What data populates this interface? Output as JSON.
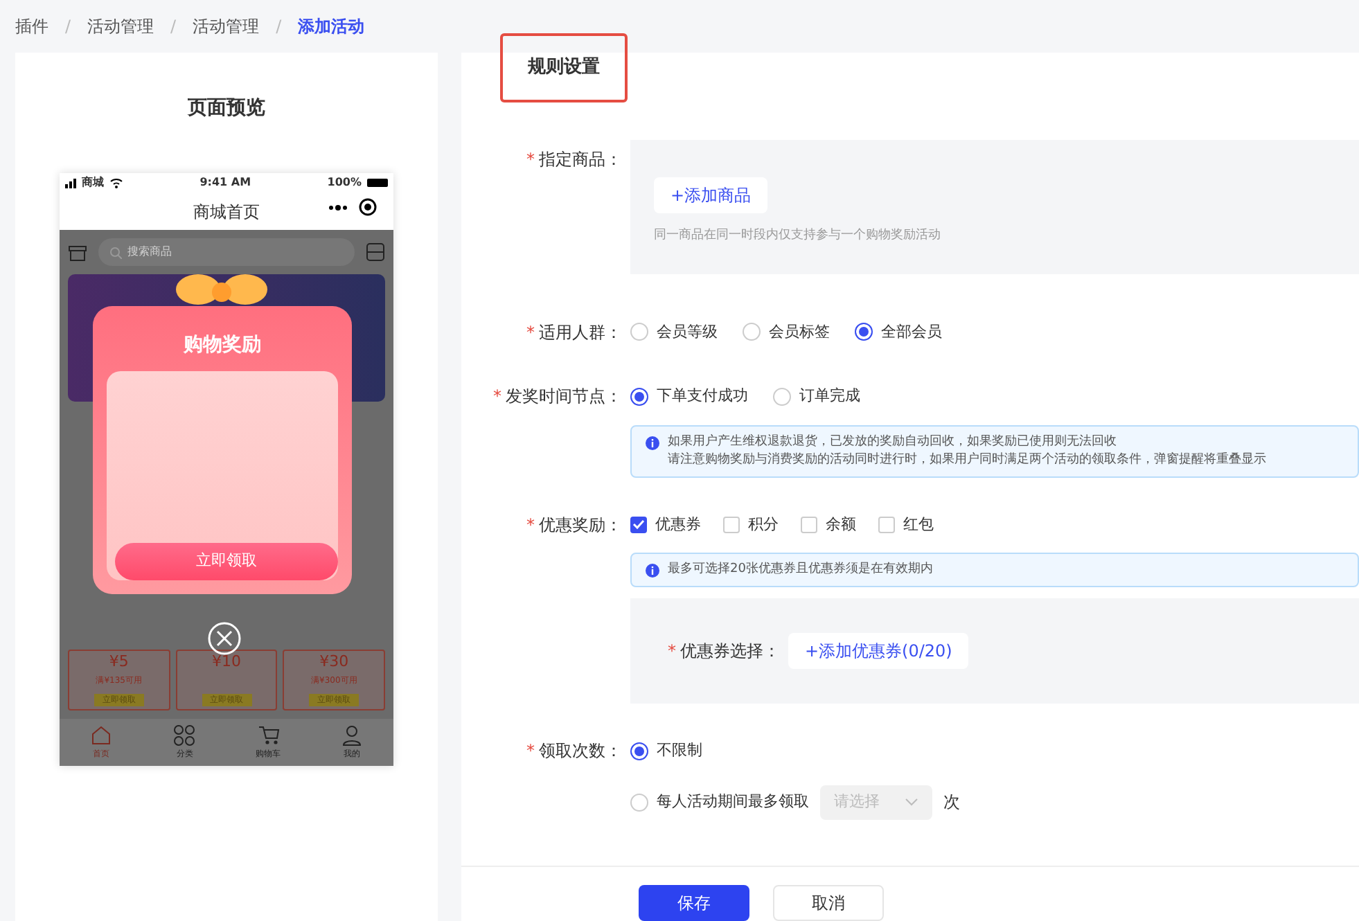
{
  "breadcrumb_separator": "/",
  "breadcrumb": [
    {
      "label": "插件",
      "selected": false
    },
    {
      "label": "活动管理",
      "selected": false
    },
    {
      "label": "活动管理",
      "selected": false
    },
    {
      "label": "添加活动",
      "selected": true
    }
  ],
  "preview": {
    "title": "页面预览",
    "phone": {
      "carrier": "商城",
      "time": "9:41 AM",
      "battery": "100%",
      "page_title": "商城首页",
      "search_placeholder": "搜索商品",
      "popup": {
        "title": "购物奖励",
        "button": "立即领取"
      },
      "coupons": [
        {
          "value": "¥5",
          "condition": "满¥135可用",
          "button": "立即领取"
        },
        {
          "value": "¥10",
          "button": "立即领取"
        },
        {
          "value": "¥30",
          "condition": "满¥300可用",
          "button": "立即领取"
        }
      ],
      "tabs": [
        {
          "label": "首页",
          "selected": true
        },
        {
          "label": "分类",
          "selected": false
        },
        {
          "label": "购物车",
          "selected": false
        },
        {
          "label": "我的",
          "selected": false
        }
      ]
    }
  },
  "rules": {
    "title": "规则设置",
    "fields": [
      {
        "kind": "picker",
        "marker": "*",
        "label": "指定商品：",
        "button": "+添加商品",
        "hint": "同一商品在同一时段内仅支持参与一个购物奖励活动"
      },
      {
        "kind": "radio",
        "marker": "*",
        "label": "适用人群：",
        "options": [
          {
            "label": "会员等级",
            "selected": false
          },
          {
            "label": "会员标签",
            "selected": false
          },
          {
            "label": "全部会员",
            "selected": true
          }
        ]
      },
      {
        "kind": "radio",
        "marker": "*",
        "label": "发奖时间节点：",
        "options": [
          {
            "label": "下单支付成功",
            "selected": true
          },
          {
            "label": "订单完成",
            "selected": false
          }
        ],
        "notes": [
          "如果用户产生维权退款退货，已发放的奖励自动回收，如果奖励已使用则无法回收",
          "请注意购物奖励与消费奖励的活动同时进行时，如果用户同时满足两个活动的领取条件，弹窗提醒将重叠显示"
        ]
      },
      {
        "kind": "checkbox",
        "marker": "*",
        "label": "优惠奖励：",
        "options": [
          {
            "label": "优惠券",
            "checked": true
          },
          {
            "label": "积分",
            "checked": false
          },
          {
            "label": "余额",
            "checked": false
          },
          {
            "label": "红包",
            "checked": false
          }
        ],
        "notes": [
          "最多可选择20张优惠券且优惠券须是在有效期内"
        ],
        "sub": {
          "marker": "*",
          "label": "优惠券选择：",
          "button": "+添加优惠券(0/20)"
        }
      },
      {
        "kind": "radio-stack",
        "marker": "*",
        "label": "领取次数：",
        "options": [
          {
            "label": "不限制",
            "selected": true
          },
          {
            "label": "每人活动期间最多领取",
            "selected": false,
            "select_placeholder": "请选择",
            "suffix": "次"
          }
        ]
      }
    ]
  },
  "buttons": [
    {
      "label": "保存",
      "kind": "primary"
    },
    {
      "label": "取消",
      "kind": "default"
    }
  ]
}
